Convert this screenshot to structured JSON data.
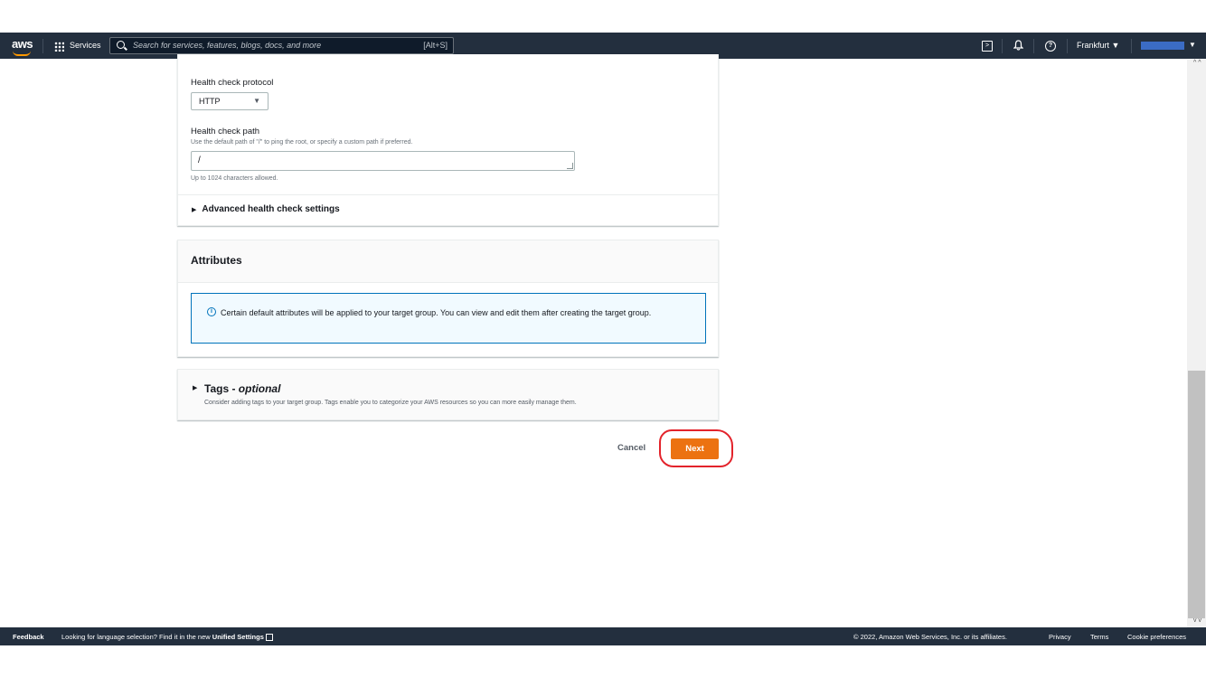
{
  "topnav": {
    "logo": "aws",
    "services_label": "Services",
    "search_placeholder": "Search for services, features, blogs, docs, and more",
    "search_shortcut": "[Alt+S]",
    "region": "Frankfurt ▼",
    "account_caret": "▼",
    "icons": [
      "grid-icon",
      "search-icon",
      "cloudshell-icon",
      "bell-icon",
      "help-icon"
    ]
  },
  "healthcheck": {
    "protocol_label": "Health check protocol",
    "protocol_value": "HTTP",
    "path_label": "Health check path",
    "path_description": "Use the default path of \"/\" to ping the root, or specify a custom path if preferred.",
    "path_value": "/",
    "path_constraint": "Up to 1024 characters allowed.",
    "advanced_label": "Advanced health check settings"
  },
  "attributes": {
    "title": "Attributes",
    "info_text": "Certain default attributes will be applied to your target group. You can view and edit them after creating the target group."
  },
  "tags": {
    "title": "Tags - ",
    "title_optional": "optional",
    "description": "Consider adding tags to your target group. Tags enable you to categorize your AWS resources so you can more easily manage them."
  },
  "actions": {
    "cancel_label": "Cancel",
    "next_label": "Next"
  },
  "footer": {
    "feedback": "Feedback",
    "language_prompt": "Looking for language selection? Find it in the new",
    "unified_settings": "Unified Settings",
    "copyright": "© 2022, Amazon Web Services, Inc. or its affiliates.",
    "privacy": "Privacy",
    "terms": "Terms",
    "cookie": "Cookie preferences"
  },
  "colors": {
    "nav_bg": "#232f3e",
    "primary_button": "#ec7211",
    "info_border": "#0073bb",
    "annotation": "#e3232b"
  }
}
